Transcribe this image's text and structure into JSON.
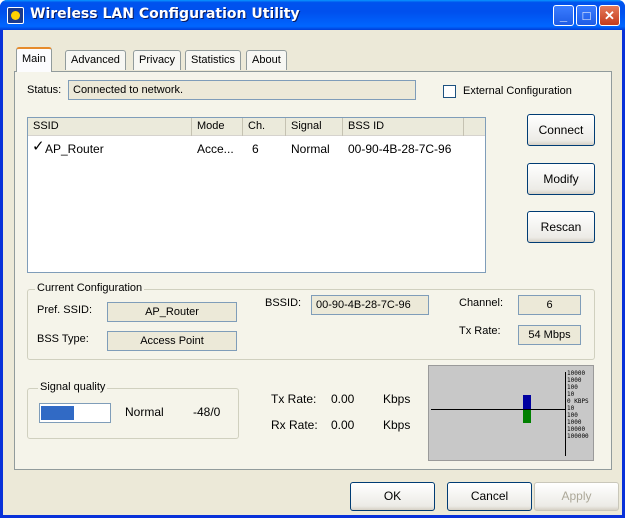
{
  "window": {
    "title": "Wireless LAN Configuration Utility",
    "minimize_glyph": "_",
    "maximize_glyph": "□",
    "close_glyph": "✕"
  },
  "tabs": [
    "Main",
    "Advanced",
    "Privacy",
    "Statistics",
    "About"
  ],
  "status": {
    "label": "Status:",
    "value": "Connected to network."
  },
  "external_config": {
    "label": "External Configuration",
    "checked": false
  },
  "network_list": {
    "columns": [
      "SSID",
      "Mode",
      "Ch.",
      "Signal",
      "BSS ID"
    ],
    "rows": [
      {
        "check": "✓",
        "ssid": "AP_Router",
        "mode": "Acce...",
        "channel": "6",
        "signal": "Normal",
        "bssid": "00-90-4B-28-7C-96"
      }
    ]
  },
  "side_buttons": {
    "connect": "Connect",
    "modify": "Modify",
    "rescan": "Rescan"
  },
  "current_configuration": {
    "title": "Current Configuration",
    "pref_ssid_label": "Pref. SSID:",
    "pref_ssid": "AP_Router",
    "bss_type_label": "BSS Type:",
    "bss_type": "Access Point",
    "bssid_label": "BSSID:",
    "bssid": "00-90-4B-28-7C-96",
    "channel_label": "Channel:",
    "channel": "6",
    "tx_rate_label": "Tx Rate:",
    "tx_rate": "54 Mbps"
  },
  "signal_quality": {
    "title": "Signal quality",
    "level_fraction": 0.48,
    "text": "Normal",
    "value": "-48/0"
  },
  "rates": {
    "tx_label": "Tx Rate:",
    "tx_value": "0.00",
    "tx_unit": "Kbps",
    "rx_label": "Rx Rate:",
    "rx_value": "0.00",
    "rx_unit": "Kbps"
  },
  "graph": {
    "scale_labels": [
      "10000",
      "1000",
      "100",
      "10",
      "0 KBPS",
      "10",
      "100",
      "1000",
      "10000",
      "100000"
    ],
    "colors": {
      "tx": "#0000a0",
      "rx": "#008000",
      "background": "#c8c8c8"
    }
  },
  "dialog_buttons": {
    "ok": "OK",
    "cancel": "Cancel",
    "apply": "Apply"
  }
}
